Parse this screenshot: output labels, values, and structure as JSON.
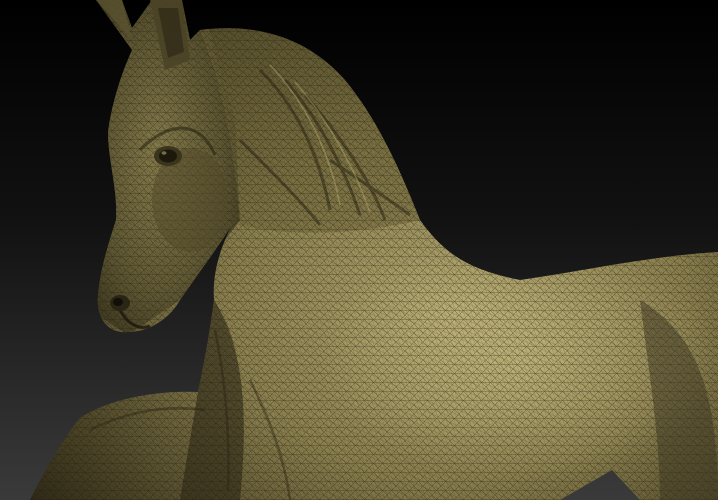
{
  "scene": {
    "subject": "horse",
    "render_style": "sculpt-wireframe",
    "colors": {
      "bg_top": "#000000",
      "bg_bottom": "#3a3a3a",
      "body_light": "#b3a770",
      "body_mid": "#8a7f4e",
      "body_dark": "#4a4326",
      "body_deep": "#2a2514",
      "wire": "#1e1a0c"
    }
  }
}
